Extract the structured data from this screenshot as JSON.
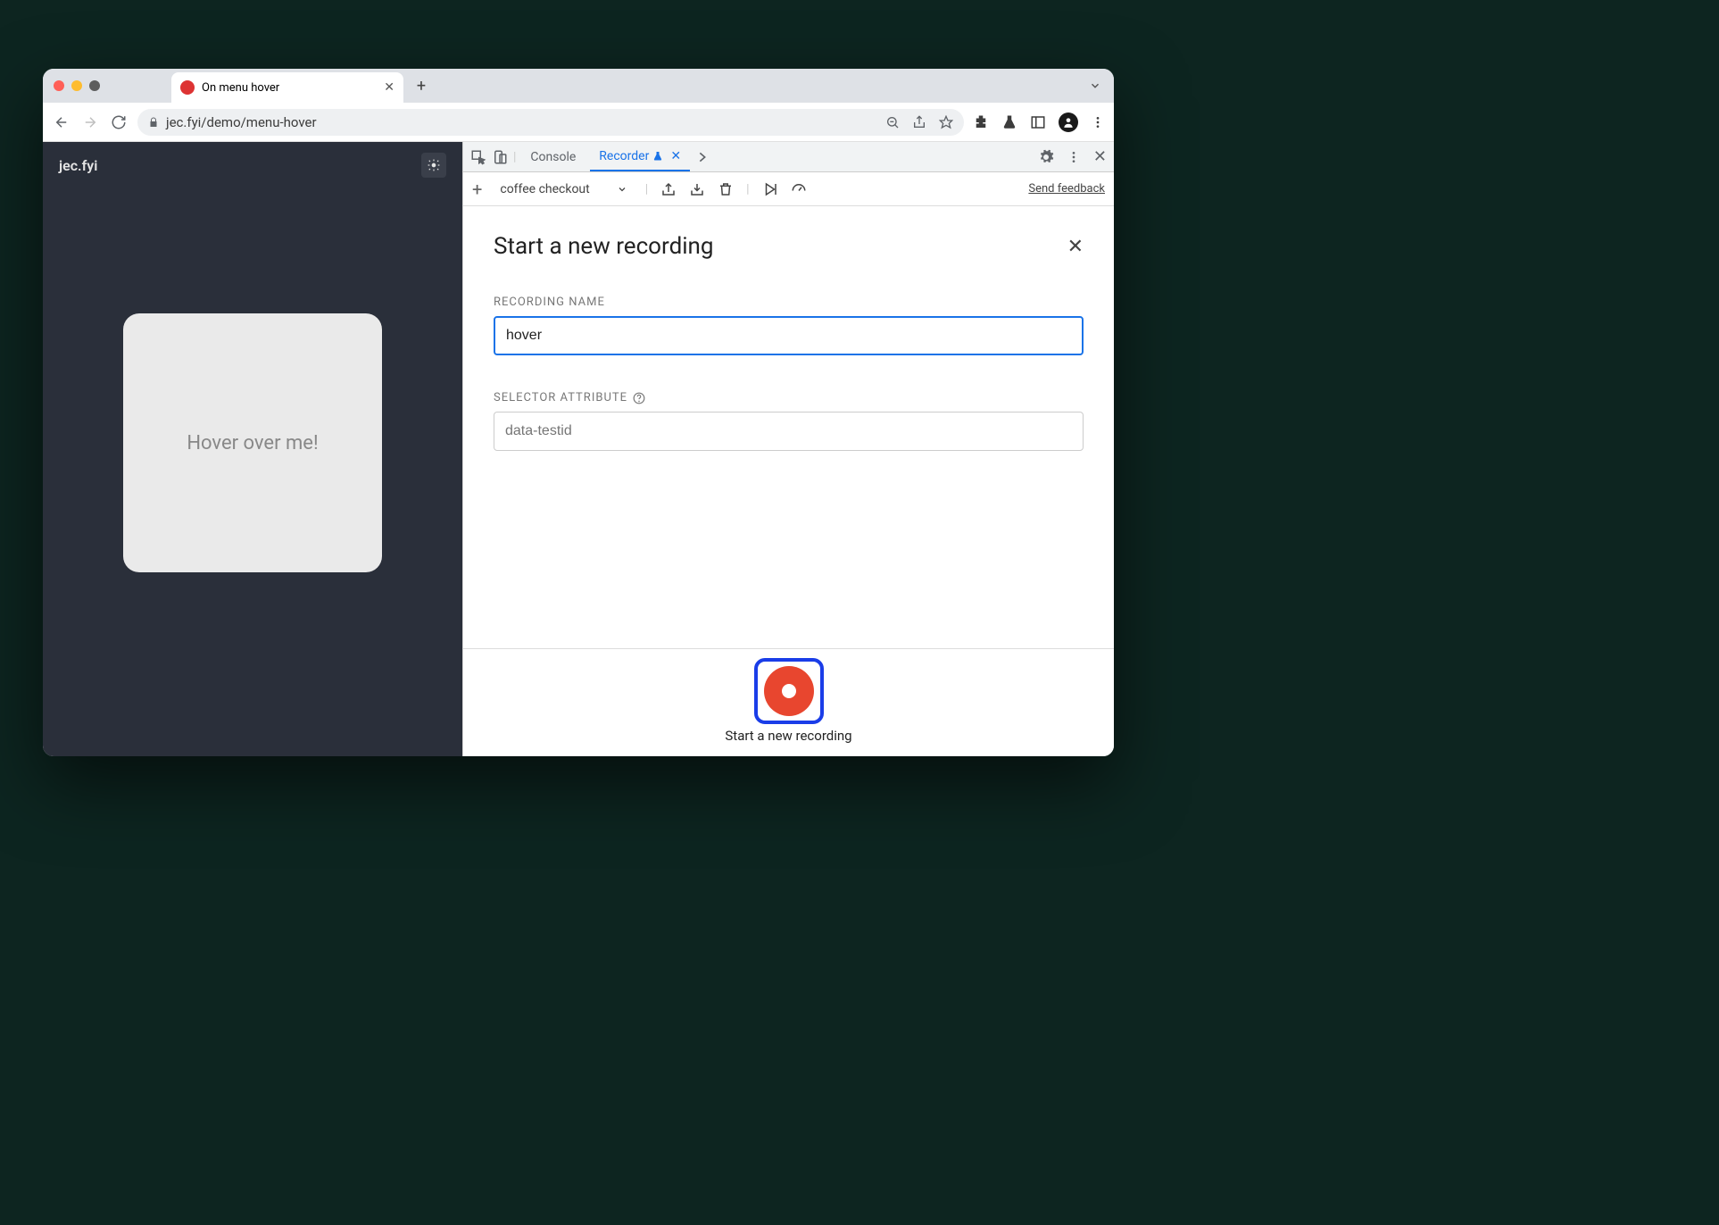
{
  "browser": {
    "tab_title": "On menu hover",
    "url": "jec.fyi/demo/menu-hover"
  },
  "page": {
    "brand": "jec.fyi",
    "card_text": "Hover over me!"
  },
  "devtools": {
    "tabs": {
      "console": "Console",
      "recorder": "Recorder"
    },
    "toolbar": {
      "dropdown": "coffee checkout",
      "feedback": "Send feedback"
    },
    "panel": {
      "title": "Start a new recording",
      "recording_name_label": "RECORDING NAME",
      "recording_name_value": "hover",
      "selector_label": "SELECTOR ATTRIBUTE",
      "selector_placeholder": "data-testid",
      "record_button_label": "Start a new recording"
    }
  }
}
